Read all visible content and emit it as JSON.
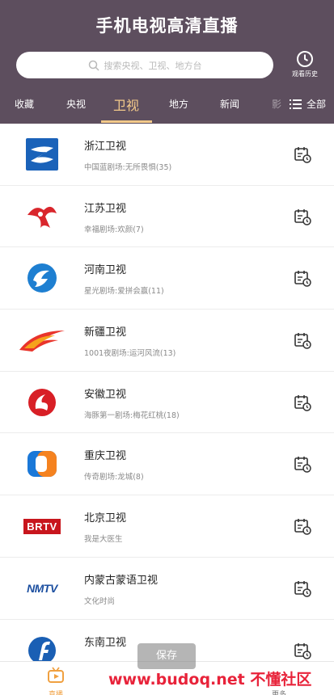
{
  "header": {
    "title": "手机电视高清直播",
    "search_placeholder": "搜索央视、卫视、地方台",
    "history_label": "观看历史"
  },
  "tabs": [
    "收藏",
    "央视",
    "卫视",
    "地方",
    "新闻",
    "影"
  ],
  "active_tab": "卫视",
  "all_label": "全部",
  "channels": [
    {
      "name": "浙江卫视",
      "program": "中国蓝剧场:无所畏惧(35)",
      "logo": "zhejiang-logo"
    },
    {
      "name": "江苏卫视",
      "program": "幸福剧场:欢颜(7)",
      "logo": "jiangsu-logo"
    },
    {
      "name": "河南卫视",
      "program": "星光剧场:爱拼会赢(11)",
      "logo": "henan-logo"
    },
    {
      "name": "新疆卫视",
      "program": "1001夜剧场:运河风流(13)",
      "logo": "xinjiang-logo"
    },
    {
      "name": "安徽卫视",
      "program": "海豚第一剧场:梅花红桃(18)",
      "logo": "anhui-logo"
    },
    {
      "name": "重庆卫视",
      "program": "传奇剧场:龙城(8)",
      "logo": "chongqing-logo"
    },
    {
      "name": "北京卫视",
      "program": "我是大医生",
      "logo": "brtv-logo",
      "logo_text": "BRTV"
    },
    {
      "name": "内蒙古蒙语卫视",
      "program": "文化时尚",
      "logo": "nmtv-logo",
      "logo_text": "NMTV"
    },
    {
      "name": "东南卫视",
      "program": "",
      "logo": "dongnan-logo"
    }
  ],
  "bottom": {
    "home_label": "直播",
    "more_label": "更多",
    "save_label": "保存",
    "watermark": "www.budoq.net 不懂社区"
  },
  "colors": {
    "header_bg": "#5d4e5e",
    "accent": "#f2c98a"
  }
}
